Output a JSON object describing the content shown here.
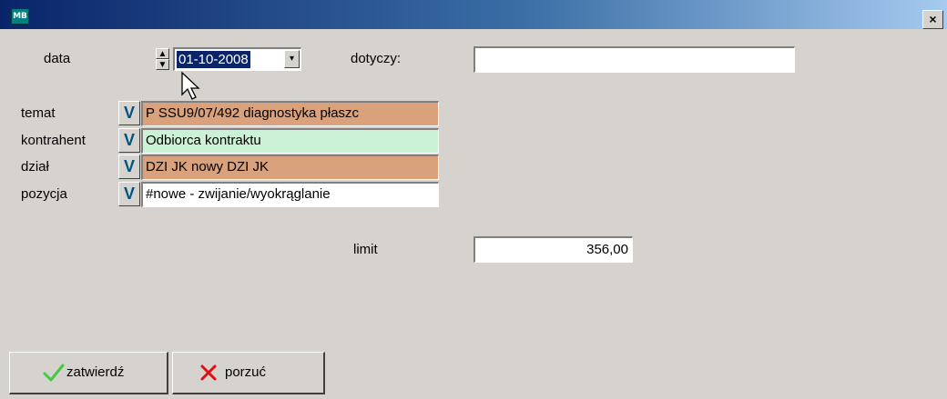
{
  "titlebar": {
    "icon_text": "MB",
    "close_glyph": "×"
  },
  "form": {
    "date_label": "data",
    "date_value": "01-10-2008",
    "dotyczy_label": "dotyczy:",
    "dotyczy_value": "",
    "rows": [
      {
        "label": "temat",
        "value": "P  SSU9/07/492    diagnostyka płaszc",
        "bg": "#d9a27c"
      },
      {
        "label": "kontrahent",
        "value": "Odbiorca kontraktu",
        "bg": "#ccf2d6"
      },
      {
        "label": "dział",
        "value": "DZI JK nowy     DZI JK",
        "bg": "#d9a27c"
      },
      {
        "label": "pozycja",
        "value": "#nowe - zwijanie/wyokrąglanie",
        "bg": "#ffffff"
      }
    ],
    "select_glyph": "V",
    "limit_label": "limit",
    "limit_value": "356,00"
  },
  "buttons": {
    "confirm_label": "zatwierdź",
    "cancel_label": "porzuć"
  },
  "icons": {
    "confirm": "checkmark-icon",
    "cancel": "cross-icon",
    "select": "select-v-icon"
  },
  "colors": {
    "title_start": "#0a246a",
    "title_end": "#a6caf0",
    "checkmark": "#46c846",
    "cross": "#e01010",
    "window_bg": "#d6d3ce"
  }
}
